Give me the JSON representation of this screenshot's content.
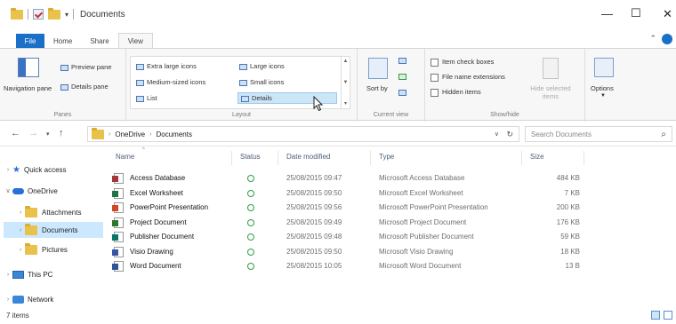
{
  "window": {
    "title": "Documents",
    "minimize": "—",
    "maximize": "☐",
    "close": "✕"
  },
  "ribbon_tabs": [
    "File",
    "Home",
    "Share",
    "View"
  ],
  "panes_group": {
    "navigation_pane": "Navigation pane",
    "preview_pane": "Preview pane",
    "details_pane": "Details pane",
    "label": "Panes"
  },
  "layout_group": {
    "items": [
      "Extra large icons",
      "Large icons",
      "Medium-sized icons",
      "Small icons",
      "List",
      "Details"
    ],
    "selected": "Details",
    "label": "Layout"
  },
  "current_view_group": {
    "sort_by": "Sort by",
    "label": "Current view"
  },
  "show_hide_group": {
    "checkboxes": [
      "Item check boxes",
      "File name extensions",
      "Hidden items"
    ],
    "hide_selected": "Hide selected items",
    "label": "Show/hide"
  },
  "options_label": "Options",
  "address": {
    "segments": [
      "OneDrive",
      "Documents"
    ],
    "search_placeholder": "Search Documents"
  },
  "nav_pane": {
    "quick_access": "Quick access",
    "onedrive": "OneDrive",
    "children": [
      "Attachments",
      "Documents",
      "Pictures"
    ],
    "selected": "Documents",
    "this_pc": "This PC",
    "network": "Network"
  },
  "columns": [
    "Name",
    "Status",
    "Date modified",
    "Type",
    "Size"
  ],
  "files": [
    {
      "name": "Access Database",
      "date": "25/08/2015 09:47",
      "type": "Microsoft Access Database",
      "size": "484 KB",
      "badge_color": "#a4373a"
    },
    {
      "name": "Excel Worksheet",
      "date": "25/08/2015 09:50",
      "type": "Microsoft Excel Worksheet",
      "size": "7 KB",
      "badge_color": "#217346"
    },
    {
      "name": "PowerPoint Presentation",
      "date": "25/08/2015 09:56",
      "type": "Microsoft PowerPoint Presentation",
      "size": "200 KB",
      "badge_color": "#d24726"
    },
    {
      "name": "Project Document",
      "date": "25/08/2015 09:49",
      "type": "Microsoft Project Document",
      "size": "176 KB",
      "badge_color": "#31752f"
    },
    {
      "name": "Publisher Document",
      "date": "25/08/2015 09:48",
      "type": "Microsoft Publisher Document",
      "size": "59 KB",
      "badge_color": "#077568"
    },
    {
      "name": "Visio Drawing",
      "date": "25/08/2015 09:50",
      "type": "Microsoft Visio Drawing",
      "size": "18 KB",
      "badge_color": "#3955a3"
    },
    {
      "name": "Word Document",
      "date": "25/08/2015 10:05",
      "type": "Microsoft Word Document",
      "size": "13 B",
      "badge_color": "#2b579a"
    }
  ],
  "status_bar": {
    "item_count": "7 items"
  }
}
